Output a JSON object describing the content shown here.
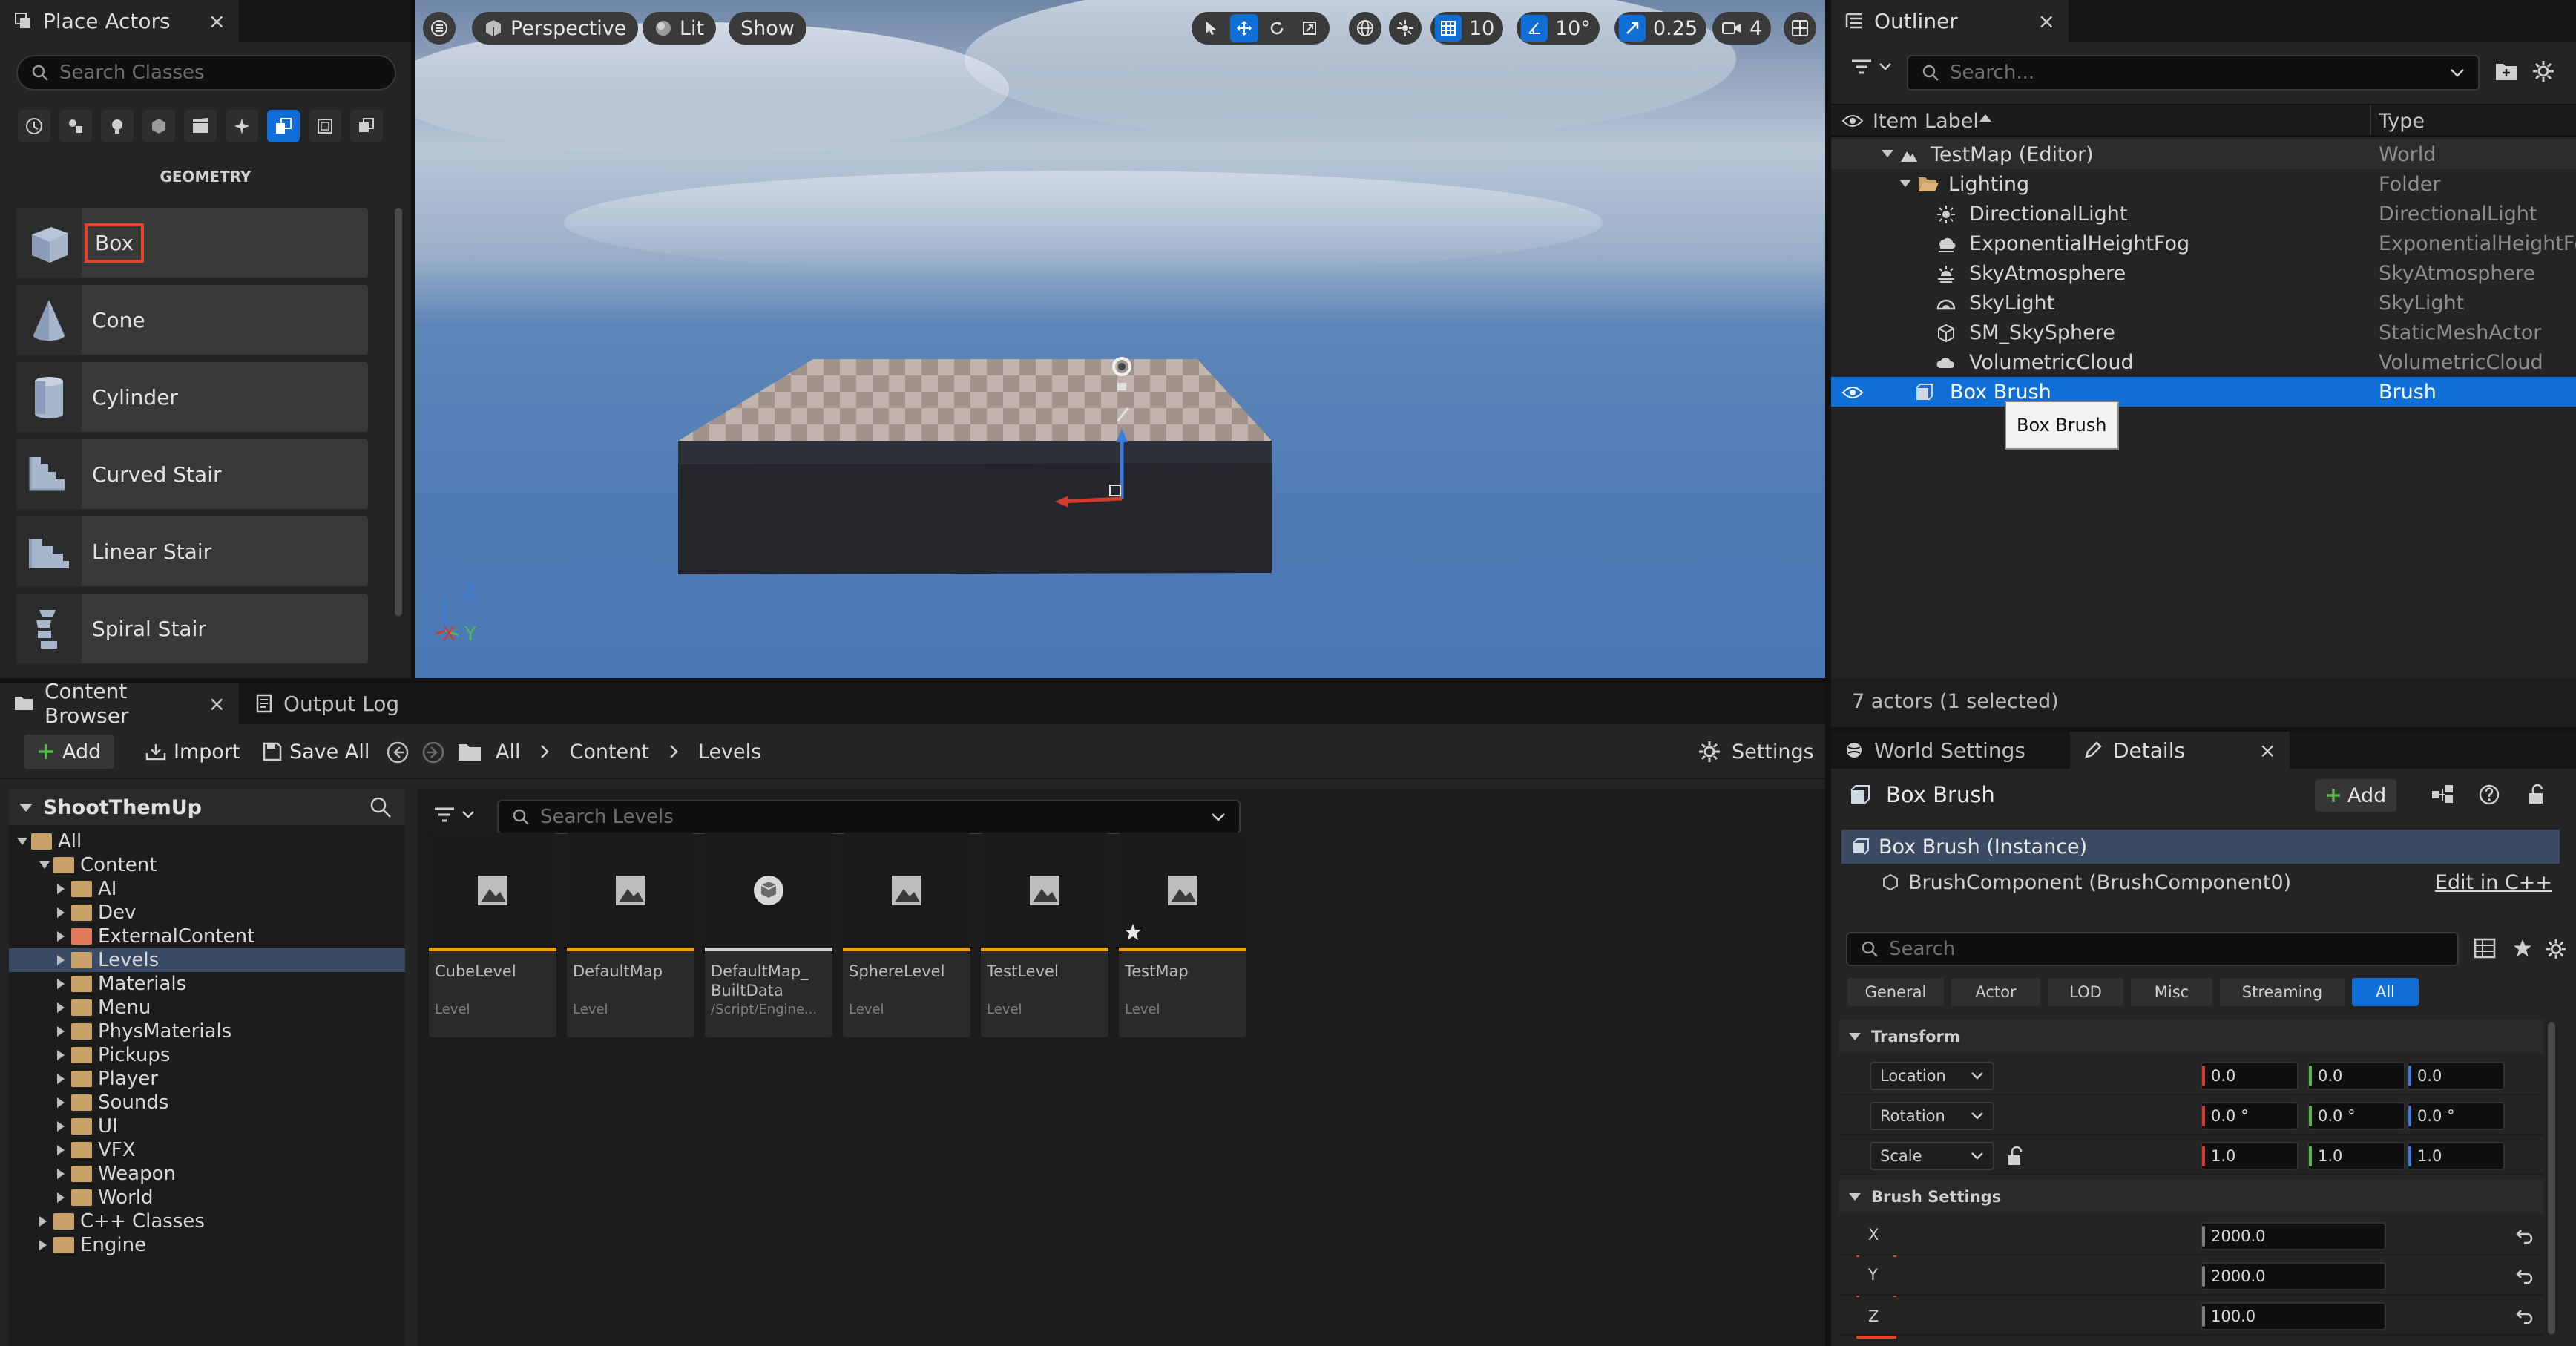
{
  "place_actors": {
    "tab_label": "Place Actors",
    "close_glyph": "×",
    "search_placeholder": "Search Classes",
    "category_label": "GEOMETRY",
    "categories": [
      "recently-placed-icon",
      "basic-icon",
      "lights-icon",
      "shapes-icon",
      "cinematic-icon",
      "visual-effects-icon",
      "geometry-icon",
      "volumes-icon",
      "all-classes-icon"
    ],
    "items": [
      {
        "label": "Box",
        "highlighted": true
      },
      {
        "label": "Cone"
      },
      {
        "label": "Cylinder"
      },
      {
        "label": "Curved Stair"
      },
      {
        "label": "Linear Stair"
      },
      {
        "label": "Spiral Stair"
      }
    ]
  },
  "viewport": {
    "perspective_label": "Perspective",
    "lit_label": "Lit",
    "show_label": "Show",
    "grid_snap_value": "10",
    "rotation_snap_value": "10°",
    "scale_snap_value": "0.25",
    "camera_speed_value": "4",
    "axis_z": "Z",
    "axis_x": "X",
    "axis_y": "Y"
  },
  "outliner": {
    "tab_label": "Outliner",
    "close_glyph": "×",
    "search_placeholder": "Search...",
    "col_label": "Item Label",
    "col_type": "Type",
    "rows": [
      {
        "label": "TestMap (Editor)",
        "type": "World"
      },
      {
        "label": "Lighting",
        "type": "Folder"
      },
      {
        "label": "DirectionalLight",
        "type": "DirectionalLight"
      },
      {
        "label": "ExponentialHeightFog",
        "type": "ExponentialHeightFog"
      },
      {
        "label": "SkyAtmosphere",
        "type": "SkyAtmosphere"
      },
      {
        "label": "SkyLight",
        "type": "SkyLight"
      },
      {
        "label": "SM_SkySphere",
        "type": "StaticMeshActor"
      },
      {
        "label": "VolumetricCloud",
        "type": "VolumetricCloud"
      },
      {
        "label": "Box Brush",
        "type": "Brush",
        "selected": true
      }
    ],
    "tooltip": "Box Brush",
    "status": "7 actors (1 selected)"
  },
  "content_browser": {
    "tab_label": "Content Browser",
    "output_log_label": "Output Log",
    "close_glyph": "×",
    "add_label": "Add",
    "import_label": "Import",
    "save_all_label": "Save All",
    "breadcrumb": [
      "All",
      "Content",
      "Levels"
    ],
    "settings_label": "Settings",
    "project_name": "ShootThemUp",
    "search_levels_placeholder": "Search Levels",
    "tree": [
      {
        "label": "All",
        "depth": 0,
        "expanded": true
      },
      {
        "label": "Content",
        "depth": 1,
        "expanded": true
      },
      {
        "label": "AI",
        "depth": 2
      },
      {
        "label": "Dev",
        "depth": 2
      },
      {
        "label": "ExternalContent",
        "depth": 2
      },
      {
        "label": "Levels",
        "depth": 2,
        "selected": true
      },
      {
        "label": "Materials",
        "depth": 2
      },
      {
        "label": "Menu",
        "depth": 2
      },
      {
        "label": "PhysMaterials",
        "depth": 2
      },
      {
        "label": "Pickups",
        "depth": 2
      },
      {
        "label": "Player",
        "depth": 2
      },
      {
        "label": "Sounds",
        "depth": 2
      },
      {
        "label": "UI",
        "depth": 2
      },
      {
        "label": "VFX",
        "depth": 2
      },
      {
        "label": "Weapon",
        "depth": 2
      },
      {
        "label": "World",
        "depth": 2
      },
      {
        "label": "C++ Classes",
        "depth": 1
      },
      {
        "label": "Engine",
        "depth": 1
      }
    ],
    "assets": [
      {
        "name": "CubeLevel",
        "type": "Level"
      },
      {
        "name": "DefaultMap",
        "type": "Level"
      },
      {
        "name": "DefaultMap_ BuiltData",
        "type": "/Script/Engine..."
      },
      {
        "name": "SphereLevel",
        "type": "Level"
      },
      {
        "name": "TestLevel",
        "type": "Level"
      },
      {
        "name": "TestMap",
        "type": "Level"
      }
    ]
  },
  "details": {
    "world_settings_label": "World Settings",
    "details_label": "Details",
    "close_glyph": "×",
    "actor_name": "Box Brush",
    "add_label": "Add",
    "instance_label": "Box Brush (Instance)",
    "component_label": "BrushComponent (BrushComponent0)",
    "edit_cpp_label": "Edit in C++",
    "search_placeholder": "Search",
    "filters": [
      "General",
      "Actor",
      "LOD",
      "Misc",
      "Streaming",
      "All"
    ],
    "transform_label": "Transform",
    "location_label": "Location",
    "rotation_label": "Rotation",
    "scale_label": "Scale",
    "location": [
      "0.0",
      "0.0",
      "0.0"
    ],
    "rotation": [
      "0.0 °",
      "0.0 °",
      "0.0 °"
    ],
    "scale": [
      "1.0",
      "1.0",
      "1.0"
    ],
    "brush_settings_label": "Brush Settings",
    "brush": [
      {
        "label": "X",
        "value": "2000.0"
      },
      {
        "label": "Y",
        "value": "2000.0"
      },
      {
        "label": "Z",
        "value": "100.0"
      }
    ]
  },
  "colors": {
    "selection": "#0f6fd6",
    "highlight_outline": "#e0452b",
    "axis_x": "#d43a2a",
    "axis_y": "#56b84a",
    "axis_z": "#3c7be0"
  }
}
